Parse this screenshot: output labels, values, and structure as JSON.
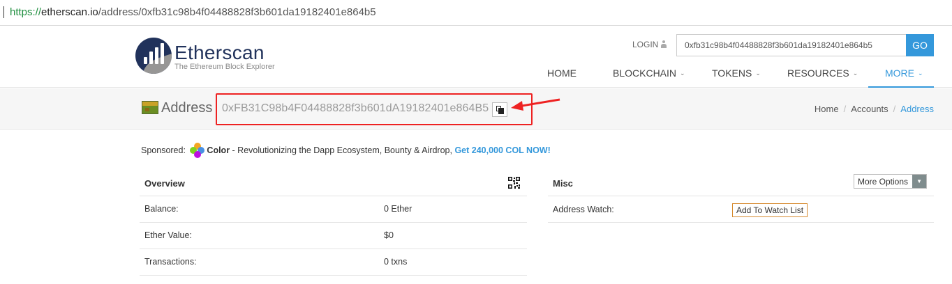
{
  "browser": {
    "url_scheme": "https://",
    "url_host": "etherscan.io",
    "url_path": "/address/0xfb31c98b4f04488828f3b601da19182401e864b5"
  },
  "header": {
    "brand_name": "Etherscan",
    "brand_tagline": "The Ethereum Block Explorer",
    "login_label": "LOGIN",
    "search_value": "0xfb31c98b4f04488828f3b601da19182401e864b5",
    "search_button": "GO",
    "brand_color": "#21325b",
    "accent_color": "#3498db"
  },
  "nav": {
    "items": [
      {
        "label": "HOME",
        "has_dropdown": false
      },
      {
        "label": "BLOCKCHAIN",
        "has_dropdown": true
      },
      {
        "label": "TOKENS",
        "has_dropdown": true
      },
      {
        "label": "RESOURCES",
        "has_dropdown": true
      },
      {
        "label": "MORE",
        "has_dropdown": true,
        "active": true
      }
    ]
  },
  "page": {
    "title": "Address",
    "address": "0xFB31C98b4F04488828f3b601dA19182401e864B5",
    "breadcrumb": [
      "Home",
      "Accounts",
      "Address"
    ]
  },
  "sponsored": {
    "prefix": "Sponsored:",
    "brand": "Color",
    "text": " - Revolutionizing the Dapp Ecosystem, Bounty & Airdrop, ",
    "cta": "Get 240,000 COL NOW!"
  },
  "overview": {
    "title": "Overview",
    "rows": [
      {
        "label": "Balance:",
        "value": "0 Ether"
      },
      {
        "label": "Ether Value:",
        "value": "$0"
      },
      {
        "label": "Transactions:",
        "value": "0 txns"
      }
    ]
  },
  "misc": {
    "title": "Misc",
    "more_options": "More Options",
    "address_watch_label": "Address Watch:",
    "watch_button": "Add To Watch List"
  }
}
